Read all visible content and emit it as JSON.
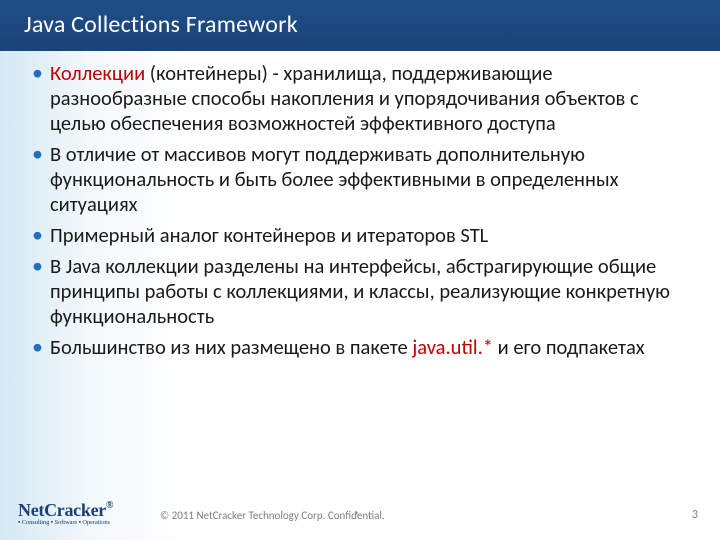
{
  "title": "Java Collections Framework",
  "bullets": {
    "b0": {
      "hl": "Коллекции",
      "rest": " (контейнеры) - хранилища, поддерживающие разнообразные способы накопления и упорядочивания объектов с целью обеспечения возможностей эффективного доступа"
    },
    "b1": "В отличие от массивов могут поддерживать дополнительную функциональность и быть более эффективными в определенных ситуациях",
    "b2": "Примерный аналог контейнеров и итераторов STL",
    "b3": "В Java коллекции разделены на интерфейсы, абстрагирующие общие принципы работы с коллекциями, и классы, реализующие конкретную функциональность",
    "b4": {
      "pre": "Большинство из них размещено в пакете ",
      "hl": "java.util.*",
      "post": " и его подпакетах"
    }
  },
  "footer": {
    "logo_main": "NetCracker",
    "logo_reg": "®",
    "logo_tag": "▪ Consulting ▪ Software ▪ Operations",
    "copyright": "© 2011 NetCracker Technology Corp. Confidential.",
    "asterisk": "*",
    "page": "3"
  }
}
